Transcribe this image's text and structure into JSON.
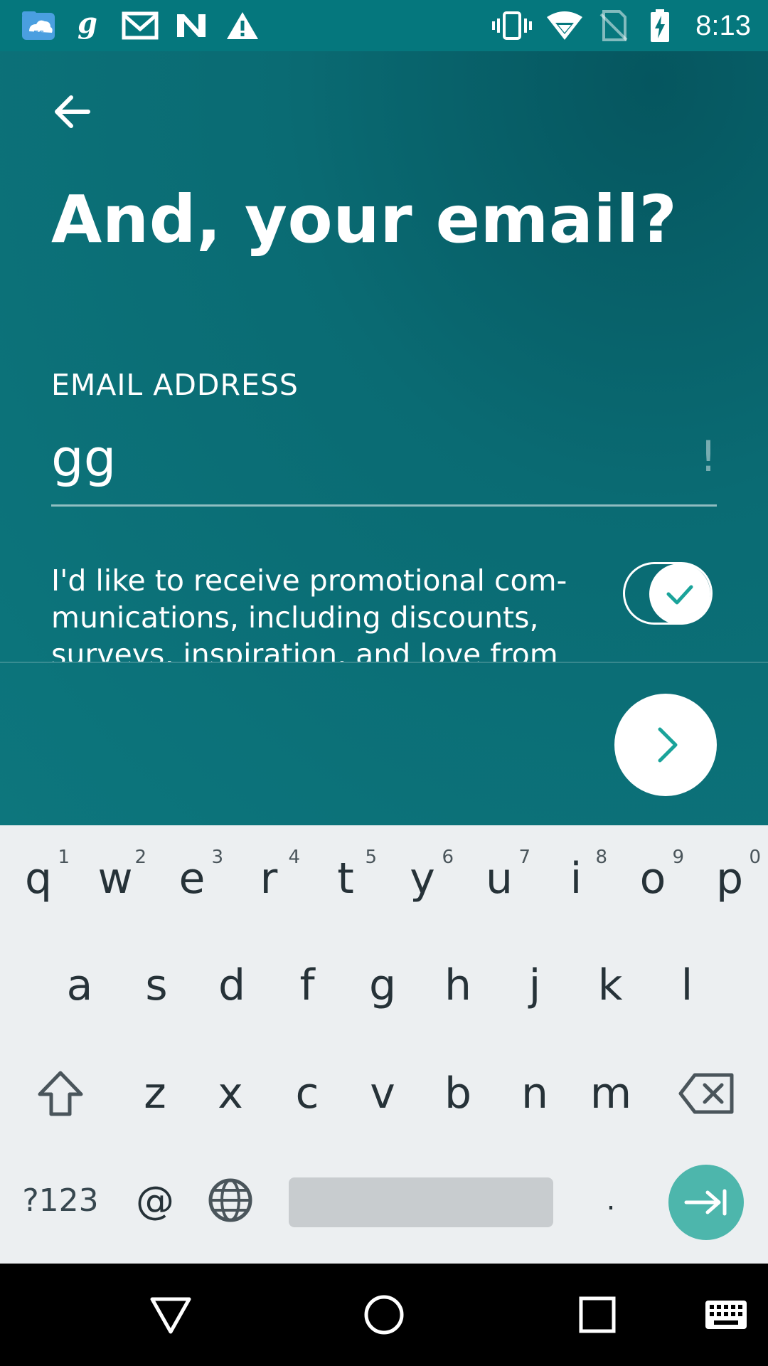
{
  "status_bar": {
    "time": "8:13",
    "left_icons": [
      "es-file-explorer-icon",
      "goodreads-icon",
      "gmail-icon",
      "n-app-icon",
      "warning-icon"
    ],
    "right_icons": [
      "vibrate-icon",
      "wifi-icon",
      "no-sim-icon",
      "battery-charging-icon"
    ]
  },
  "page": {
    "title": "And, your email?",
    "email_label": "EMAIL ADDRESS",
    "email_value": "gg",
    "email_error_indicator": "!",
    "promo_text": "I'd like to receive promotional com-munications, including discounts, surveys, inspiration, and love from",
    "promo_toggle_on": true
  },
  "keyboard": {
    "row1": [
      {
        "key": "q",
        "hint": "1"
      },
      {
        "key": "w",
        "hint": "2"
      },
      {
        "key": "e",
        "hint": "3"
      },
      {
        "key": "r",
        "hint": "4"
      },
      {
        "key": "t",
        "hint": "5"
      },
      {
        "key": "y",
        "hint": "6"
      },
      {
        "key": "u",
        "hint": "7"
      },
      {
        "key": "i",
        "hint": "8"
      },
      {
        "key": "o",
        "hint": "9"
      },
      {
        "key": "p",
        "hint": "0"
      }
    ],
    "row2": [
      "a",
      "s",
      "d",
      "f",
      "g",
      "h",
      "j",
      "k",
      "l"
    ],
    "row3": [
      "z",
      "x",
      "c",
      "v",
      "b",
      "n",
      "m"
    ],
    "row4": {
      "symbols": "?123",
      "at": "@",
      "period": "."
    }
  },
  "colors": {
    "app_bg": "#0a6b73",
    "accent": "#1aa39a",
    "enter_key": "#4db6ac",
    "keyboard_bg": "#eceff1"
  }
}
